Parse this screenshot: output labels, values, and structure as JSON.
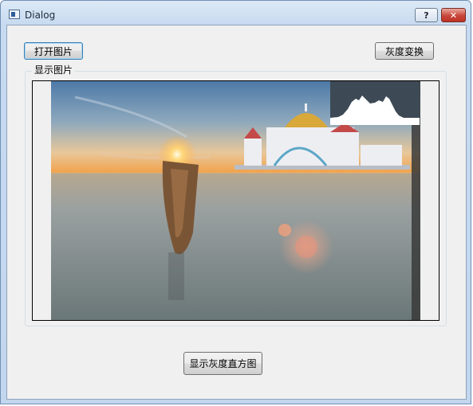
{
  "window": {
    "title": "Dialog"
  },
  "titlebar": {
    "help_label": "?",
    "close_label": "✕"
  },
  "toolbar": {
    "open_label": "打开图片",
    "gray_label": "灰度变换"
  },
  "display": {
    "group_title": "显示图片"
  },
  "bottom": {
    "histogram_label": "显示灰度直方图"
  },
  "icons": {
    "app": "dialog-app-icon",
    "help": "question-mark-icon",
    "close": "close-icon"
  },
  "colors": {
    "sky_top": "#4d7aa8",
    "sunset": "#f2a24a",
    "sea": "#7e8b8c",
    "dome": "#d9a83a",
    "close_button": "#c8463a"
  }
}
